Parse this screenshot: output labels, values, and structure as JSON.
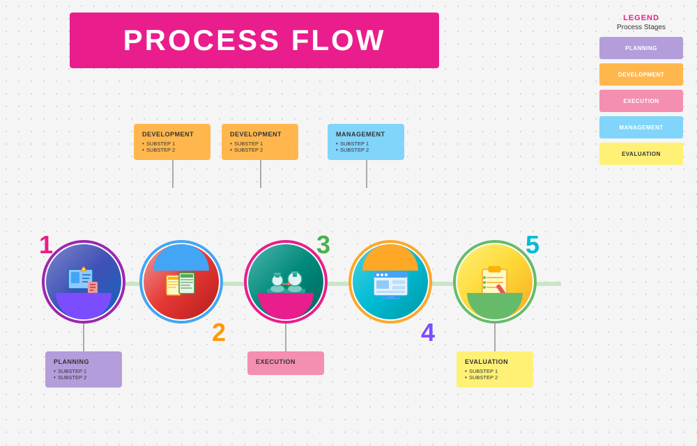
{
  "title": "PROCESS FLOW",
  "legend": {
    "title": "LEGEND",
    "subtitle": "Process Stages",
    "items": [
      {
        "label": "PLANNING",
        "color": "#b39ddb"
      },
      {
        "label": "DEVELOPMENT",
        "color": "#ffb74d"
      },
      {
        "label": "EXECUTION",
        "color": "#f48fb1"
      },
      {
        "label": "MANAGEMENT",
        "color": "#81d4fa"
      },
      {
        "label": "EVALUATION",
        "color": "#fff176"
      }
    ]
  },
  "stages": [
    {
      "number": "1",
      "label": "PLANNING",
      "box_position": "below",
      "box_color": "#b39ddb",
      "substeps": [
        "SUBSTEP 1",
        "SUBSTEP 2"
      ]
    },
    {
      "number": "2",
      "label": "DEVELOPMENT",
      "box_position": "above",
      "box_color": "#ffb74d",
      "substeps": [
        "SUBSTEP 1",
        "SUBSTEP 2"
      ]
    },
    {
      "number": "3",
      "label": "EXECUTION",
      "box_position": "below",
      "box_color": "#f48fb1",
      "substeps": []
    },
    {
      "number": "4",
      "label": "MANAGEMENT",
      "box_position": "above",
      "box_color": "#81d4fa",
      "substeps": [
        "SUBSTEP 1",
        "SUBSTEP 2"
      ]
    },
    {
      "number": "5",
      "label": "EVALUATION",
      "box_position": "below",
      "box_color": "#fff176",
      "substeps": [
        "SUBSTEP 1",
        "SUBSTEP 2"
      ]
    }
  ]
}
